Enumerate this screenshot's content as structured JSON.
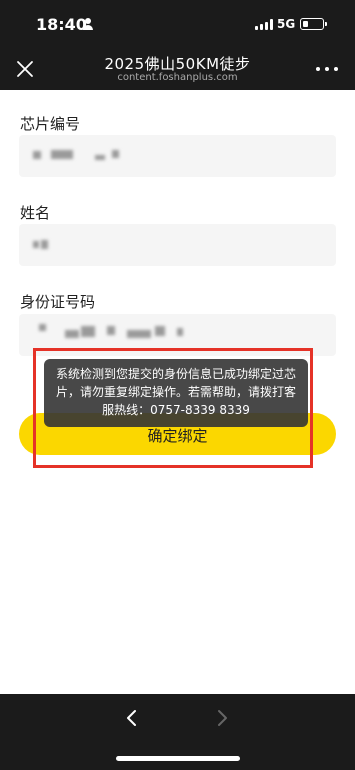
{
  "status_bar": {
    "time": "18:40",
    "network": "5G",
    "battery_level": 0.3,
    "icons": [
      "person-icon",
      "signal-icon",
      "battery-icon"
    ]
  },
  "nav": {
    "title": "2025佛山50KM徒步",
    "subtitle": "content.foshanplus.com",
    "icons": [
      "close-icon",
      "more-icon"
    ]
  },
  "form": {
    "chip_label": "芯片编号",
    "name_label": "姓名",
    "id_label": "身份证号码"
  },
  "confirm_label": "确定绑定",
  "toast": {
    "message": "系统检测到您提交的身份信息已成功绑定过芯片，请勿重复绑定操作。若需帮助，请拨打客服热线：0757-8339 8339",
    "highlight_color": "#e53227"
  },
  "colors": {
    "accent": "#fbd700",
    "bar": "#1b1b1b"
  },
  "bottom_bar": {
    "icons": [
      "back-chevron-icon",
      "forward-chevron-icon"
    ]
  }
}
